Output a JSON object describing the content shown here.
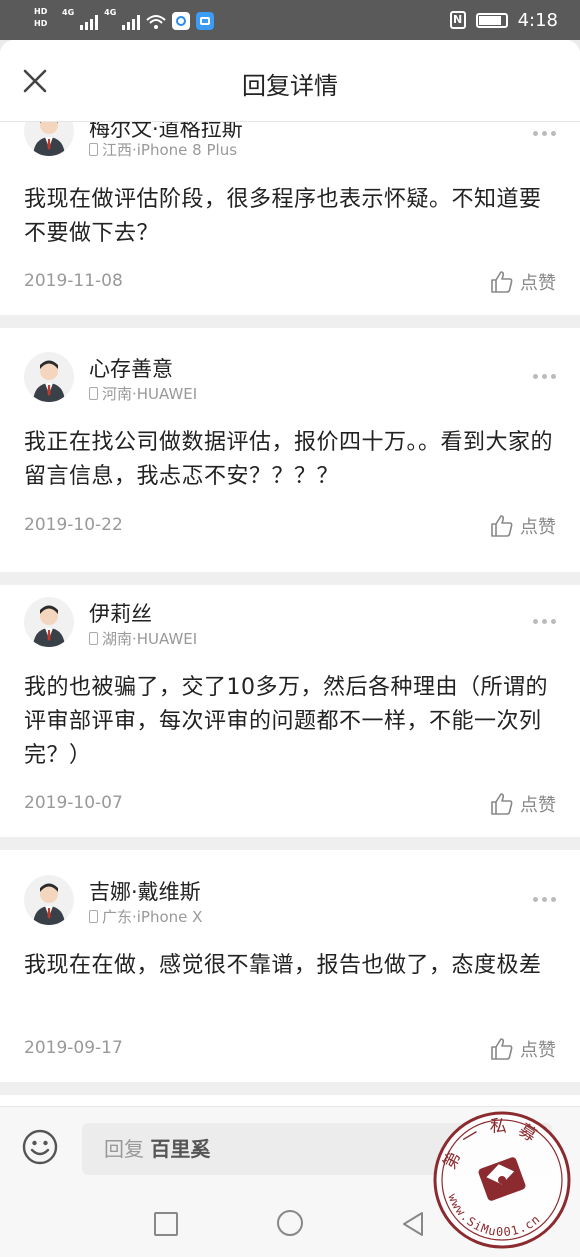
{
  "status": {
    "left_badges": [
      "HD",
      "HD"
    ],
    "net": "4G",
    "net2": "4G",
    "time": "4:18"
  },
  "header": {
    "title": "回复详情"
  },
  "comments": [
    {
      "user": "梅尔文·道格拉斯",
      "device": "江西·iPhone 8 Plus",
      "content": "我现在做评估阶段，很多程序也表示怀疑。不知道要不要做下去？",
      "date": "2019-11-08",
      "like_label": "点赞"
    },
    {
      "user": "心存善意",
      "device": "河南·HUAWEI",
      "content": "我正在找公司做数据评估，报价四十万。。看到大家的留言信息，我忐忑不安？？？？",
      "date": "2019-10-22",
      "like_label": "点赞"
    },
    {
      "user": "伊莉丝",
      "device": "湖南·HUAWEI",
      "content": "我的也被骗了，交了10多万，然后各种理由（所谓的评审部评审，每次评审的问题都不一样，不能一次列完？）",
      "date": "2019-10-07",
      "like_label": "点赞"
    },
    {
      "user": "吉娜·戴维斯",
      "device": "广东·iPhone X",
      "content": "我现在在做，感觉很不靠谱，报告也做了，态度极差",
      "date": "2019-09-17",
      "like_label": "点赞"
    }
  ],
  "reply": {
    "prefix": "回复",
    "target": "百里奚"
  },
  "watermark": {
    "top_text": "第一私募",
    "bottom_text": "www.SiMu001.cn"
  },
  "colors": {
    "status_bg": "#5a5a5a",
    "divider": "#efefef",
    "watermark": "#8b2a2f"
  }
}
